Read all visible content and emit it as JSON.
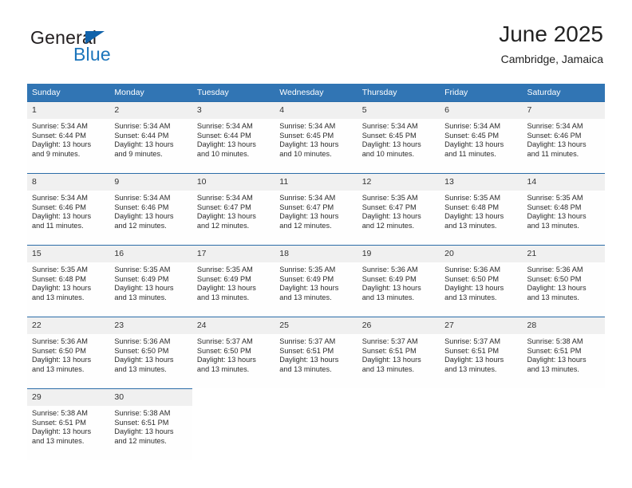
{
  "brand": {
    "word_one": "General",
    "word_two": "Blue",
    "triangle_color": "#1163ab",
    "blue_color": "#1b75bb"
  },
  "header": {
    "title": "June 2025",
    "subtitle": "Cambridge, Jamaica"
  },
  "theme": {
    "header_row_bg": "#3175b4",
    "week_rule": "#2b6ca8",
    "daynum_bg": "#f0f0f0"
  },
  "weekdays": [
    "Sunday",
    "Monday",
    "Tuesday",
    "Wednesday",
    "Thursday",
    "Friday",
    "Saturday"
  ],
  "weeks": [
    [
      {
        "day": "1",
        "sunrise": "Sunrise: 5:34 AM",
        "sunset": "Sunset: 6:44 PM",
        "daylight_1": "Daylight: 13 hours",
        "daylight_2": "and 9 minutes."
      },
      {
        "day": "2",
        "sunrise": "Sunrise: 5:34 AM",
        "sunset": "Sunset: 6:44 PM",
        "daylight_1": "Daylight: 13 hours",
        "daylight_2": "and 9 minutes."
      },
      {
        "day": "3",
        "sunrise": "Sunrise: 5:34 AM",
        "sunset": "Sunset: 6:44 PM",
        "daylight_1": "Daylight: 13 hours",
        "daylight_2": "and 10 minutes."
      },
      {
        "day": "4",
        "sunrise": "Sunrise: 5:34 AM",
        "sunset": "Sunset: 6:45 PM",
        "daylight_1": "Daylight: 13 hours",
        "daylight_2": "and 10 minutes."
      },
      {
        "day": "5",
        "sunrise": "Sunrise: 5:34 AM",
        "sunset": "Sunset: 6:45 PM",
        "daylight_1": "Daylight: 13 hours",
        "daylight_2": "and 10 minutes."
      },
      {
        "day": "6",
        "sunrise": "Sunrise: 5:34 AM",
        "sunset": "Sunset: 6:45 PM",
        "daylight_1": "Daylight: 13 hours",
        "daylight_2": "and 11 minutes."
      },
      {
        "day": "7",
        "sunrise": "Sunrise: 5:34 AM",
        "sunset": "Sunset: 6:46 PM",
        "daylight_1": "Daylight: 13 hours",
        "daylight_2": "and 11 minutes."
      }
    ],
    [
      {
        "day": "8",
        "sunrise": "Sunrise: 5:34 AM",
        "sunset": "Sunset: 6:46 PM",
        "daylight_1": "Daylight: 13 hours",
        "daylight_2": "and 11 minutes."
      },
      {
        "day": "9",
        "sunrise": "Sunrise: 5:34 AM",
        "sunset": "Sunset: 6:46 PM",
        "daylight_1": "Daylight: 13 hours",
        "daylight_2": "and 12 minutes."
      },
      {
        "day": "10",
        "sunrise": "Sunrise: 5:34 AM",
        "sunset": "Sunset: 6:47 PM",
        "daylight_1": "Daylight: 13 hours",
        "daylight_2": "and 12 minutes."
      },
      {
        "day": "11",
        "sunrise": "Sunrise: 5:34 AM",
        "sunset": "Sunset: 6:47 PM",
        "daylight_1": "Daylight: 13 hours",
        "daylight_2": "and 12 minutes."
      },
      {
        "day": "12",
        "sunrise": "Sunrise: 5:35 AM",
        "sunset": "Sunset: 6:47 PM",
        "daylight_1": "Daylight: 13 hours",
        "daylight_2": "and 12 minutes."
      },
      {
        "day": "13",
        "sunrise": "Sunrise: 5:35 AM",
        "sunset": "Sunset: 6:48 PM",
        "daylight_1": "Daylight: 13 hours",
        "daylight_2": "and 13 minutes."
      },
      {
        "day": "14",
        "sunrise": "Sunrise: 5:35 AM",
        "sunset": "Sunset: 6:48 PM",
        "daylight_1": "Daylight: 13 hours",
        "daylight_2": "and 13 minutes."
      }
    ],
    [
      {
        "day": "15",
        "sunrise": "Sunrise: 5:35 AM",
        "sunset": "Sunset: 6:48 PM",
        "daylight_1": "Daylight: 13 hours",
        "daylight_2": "and 13 minutes."
      },
      {
        "day": "16",
        "sunrise": "Sunrise: 5:35 AM",
        "sunset": "Sunset: 6:49 PM",
        "daylight_1": "Daylight: 13 hours",
        "daylight_2": "and 13 minutes."
      },
      {
        "day": "17",
        "sunrise": "Sunrise: 5:35 AM",
        "sunset": "Sunset: 6:49 PM",
        "daylight_1": "Daylight: 13 hours",
        "daylight_2": "and 13 minutes."
      },
      {
        "day": "18",
        "sunrise": "Sunrise: 5:35 AM",
        "sunset": "Sunset: 6:49 PM",
        "daylight_1": "Daylight: 13 hours",
        "daylight_2": "and 13 minutes."
      },
      {
        "day": "19",
        "sunrise": "Sunrise: 5:36 AM",
        "sunset": "Sunset: 6:49 PM",
        "daylight_1": "Daylight: 13 hours",
        "daylight_2": "and 13 minutes."
      },
      {
        "day": "20",
        "sunrise": "Sunrise: 5:36 AM",
        "sunset": "Sunset: 6:50 PM",
        "daylight_1": "Daylight: 13 hours",
        "daylight_2": "and 13 minutes."
      },
      {
        "day": "21",
        "sunrise": "Sunrise: 5:36 AM",
        "sunset": "Sunset: 6:50 PM",
        "daylight_1": "Daylight: 13 hours",
        "daylight_2": "and 13 minutes."
      }
    ],
    [
      {
        "day": "22",
        "sunrise": "Sunrise: 5:36 AM",
        "sunset": "Sunset: 6:50 PM",
        "daylight_1": "Daylight: 13 hours",
        "daylight_2": "and 13 minutes."
      },
      {
        "day": "23",
        "sunrise": "Sunrise: 5:36 AM",
        "sunset": "Sunset: 6:50 PM",
        "daylight_1": "Daylight: 13 hours",
        "daylight_2": "and 13 minutes."
      },
      {
        "day": "24",
        "sunrise": "Sunrise: 5:37 AM",
        "sunset": "Sunset: 6:50 PM",
        "daylight_1": "Daylight: 13 hours",
        "daylight_2": "and 13 minutes."
      },
      {
        "day": "25",
        "sunrise": "Sunrise: 5:37 AM",
        "sunset": "Sunset: 6:51 PM",
        "daylight_1": "Daylight: 13 hours",
        "daylight_2": "and 13 minutes."
      },
      {
        "day": "26",
        "sunrise": "Sunrise: 5:37 AM",
        "sunset": "Sunset: 6:51 PM",
        "daylight_1": "Daylight: 13 hours",
        "daylight_2": "and 13 minutes."
      },
      {
        "day": "27",
        "sunrise": "Sunrise: 5:37 AM",
        "sunset": "Sunset: 6:51 PM",
        "daylight_1": "Daylight: 13 hours",
        "daylight_2": "and 13 minutes."
      },
      {
        "day": "28",
        "sunrise": "Sunrise: 5:38 AM",
        "sunset": "Sunset: 6:51 PM",
        "daylight_1": "Daylight: 13 hours",
        "daylight_2": "and 13 minutes."
      }
    ],
    [
      {
        "day": "29",
        "sunrise": "Sunrise: 5:38 AM",
        "sunset": "Sunset: 6:51 PM",
        "daylight_1": "Daylight: 13 hours",
        "daylight_2": "and 13 minutes."
      },
      {
        "day": "30",
        "sunrise": "Sunrise: 5:38 AM",
        "sunset": "Sunset: 6:51 PM",
        "daylight_1": "Daylight: 13 hours",
        "daylight_2": "and 12 minutes."
      },
      {
        "day": "",
        "sunrise": "",
        "sunset": "",
        "daylight_1": "",
        "daylight_2": ""
      },
      {
        "day": "",
        "sunrise": "",
        "sunset": "",
        "daylight_1": "",
        "daylight_2": ""
      },
      {
        "day": "",
        "sunrise": "",
        "sunset": "",
        "daylight_1": "",
        "daylight_2": ""
      },
      {
        "day": "",
        "sunrise": "",
        "sunset": "",
        "daylight_1": "",
        "daylight_2": ""
      },
      {
        "day": "",
        "sunrise": "",
        "sunset": "",
        "daylight_1": "",
        "daylight_2": ""
      }
    ]
  ]
}
